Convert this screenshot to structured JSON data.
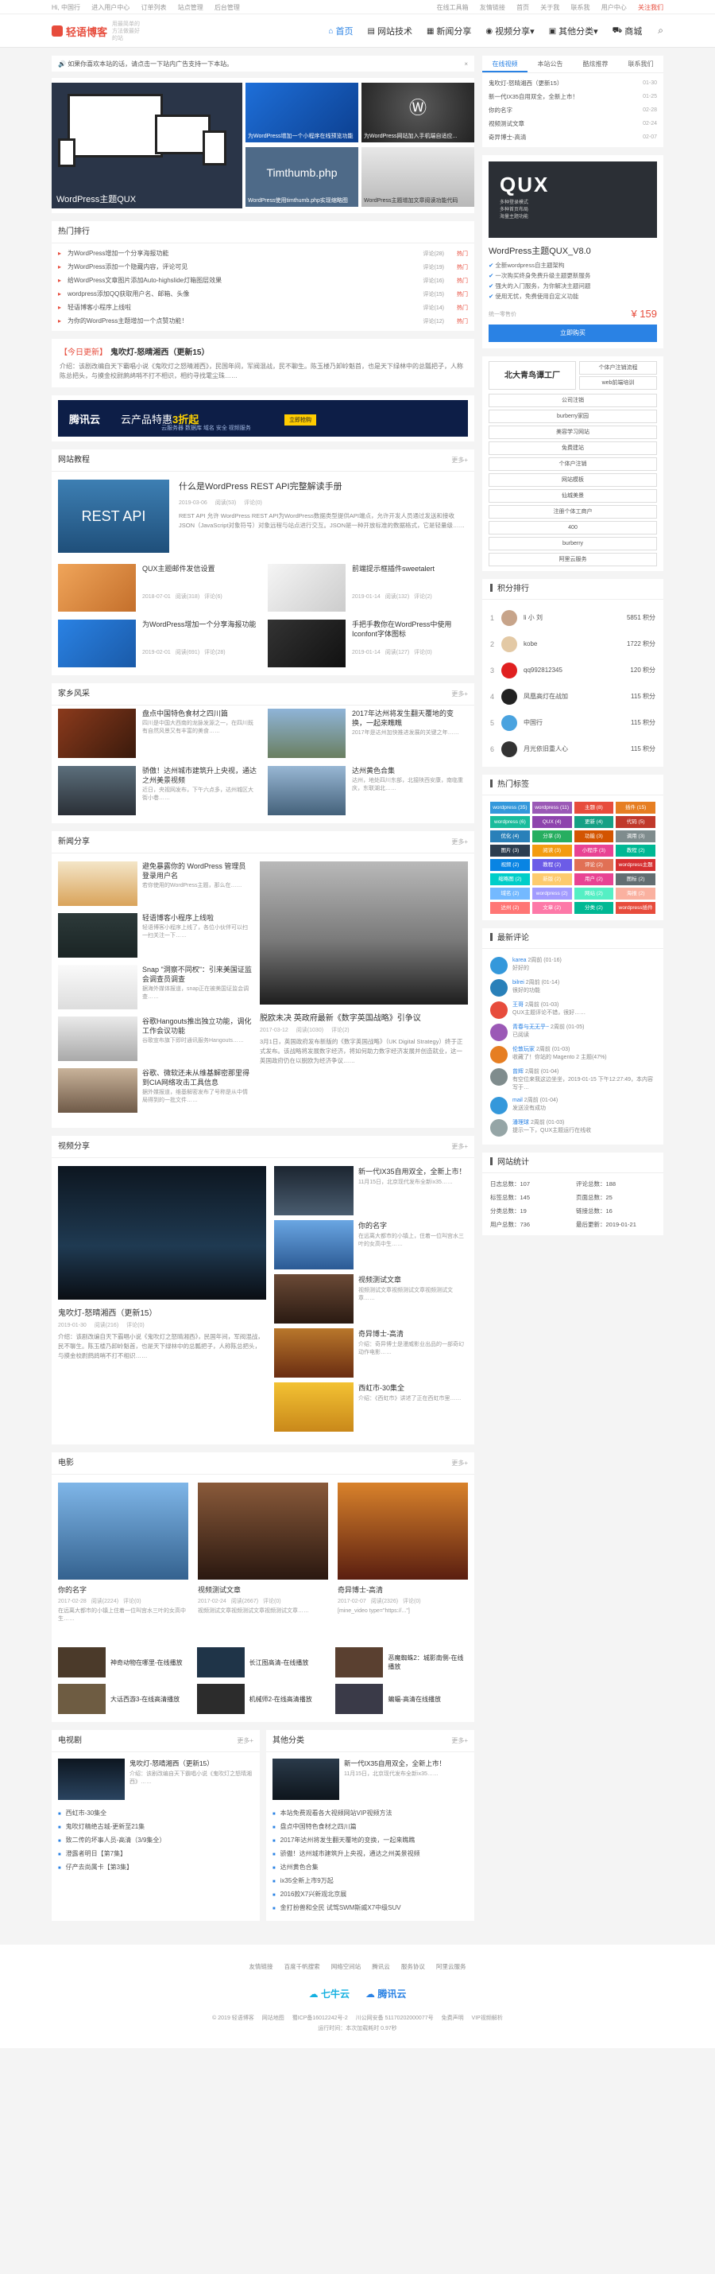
{
  "topbar": {
    "left": [
      "Hi, 中国行",
      "进入用户中心",
      "订单列表",
      "站点管理",
      "后台管理"
    ],
    "right": [
      "在线工具箱",
      "友情链接",
      "首页",
      "关于我",
      "联系我",
      "用户中心",
      "关注我们"
    ]
  },
  "header": {
    "logo": "轻语博客",
    "slogan": "用最简单的方法做最好的站",
    "nav": [
      {
        "label": "首页",
        "icon": "home-icon"
      },
      {
        "label": "网站技术",
        "icon": "code-icon"
      },
      {
        "label": "新闻分享",
        "icon": "news-icon"
      },
      {
        "label": "视频分享",
        "icon": "video-icon"
      },
      {
        "label": "其他分类",
        "icon": "grid-icon"
      },
      {
        "label": "商城",
        "icon": "cart-icon"
      }
    ]
  },
  "notice": {
    "text": "如果你喜欢本站的话，请点击一下站内广告支持一下本站。"
  },
  "slider": {
    "main_caption": "WordPress主题QUX",
    "thumbs": [
      {
        "caption": "为WordPress增加一个小程序在线预览功能"
      },
      {
        "caption": "为WordPress网站加入手机端自适应..."
      },
      {
        "title": "Timthumb.php",
        "caption": "WordPress使用timthumb.php实现缩略图"
      },
      {
        "caption": "WordPress主题增加文章阅读功能代码"
      }
    ]
  },
  "hot": {
    "title": "热门排行",
    "items": [
      {
        "t": "为WordPress增加一个分享海报功能",
        "m": "评论(28)",
        "h": "热门"
      },
      {
        "t": "为WordPress添加一个隐藏内容，评论可见",
        "m": "评论(19)",
        "h": "热门"
      },
      {
        "t": "给WordPress文章图片添加Auto-highslide灯箱图层效果",
        "m": "评论(16)",
        "h": "热门"
      },
      {
        "t": "wordpress添加QQ获取用户名、邮箱、头像",
        "m": "评论(15)",
        "h": "热门"
      },
      {
        "t": "轻语博客小程序上线啦",
        "m": "评论(14)",
        "h": "热门"
      },
      {
        "t": "为你的WordPress主题增加一个点赞功能！",
        "m": "评论(12)",
        "h": "热门"
      }
    ]
  },
  "today": {
    "label": "【今日更新】",
    "title": "鬼吹灯-怒晴湘西（更新15）",
    "text": "介绍：该剧改编自天下霸唱小说《鬼吹灯之怒晴湘西》，民国年间，军阀混战，民不聊生。陈玉楼乃卸岭魁首，也是天下绿林中的总瓢把子，人称陈总把头，与摸金校尉鹧鸪哨不打不相识，相约寻找雮尘珠……"
  },
  "ad": {
    "brand": "腾讯云",
    "text1": "云产品特惠",
    "highlight": "3折起",
    "text2": "云服务器 数据库 域名 安全 视频服务",
    "btn": "立即抢购"
  },
  "tech": {
    "title": "网站教程",
    "more": "更多+",
    "big": {
      "t": "什么是WordPress REST API完整解读手册",
      "date": "2019-03-06",
      "views": "阅读(53)",
      "comments": "评论(0)",
      "img_text": "REST API",
      "text": "REST API 允许 WordPress REST API为WordPress数据类型提供API端点，允许开发人员通过发送和接收JSON（JavaScript对象符号）对象远程与站点进行交互。JSON是一种开放标准的数据格式，它是轻量级……"
    },
    "items": [
      {
        "t": "QUX主题邮件发信设置",
        "date": "2018-07-01",
        "views": "阅读(318)",
        "c": "评论(6)"
      },
      {
        "t": "前端提示框插件sweetalert",
        "date": "2019-01-14",
        "views": "阅读(132)",
        "c": "评论(2)"
      },
      {
        "t": "为WordPress增加一个分享海报功能",
        "date": "2019-02-01",
        "views": "阅读(691)",
        "c": "评论(28)"
      },
      {
        "t": "手把手教你在WordPress中使用Iconfont字体图标",
        "date": "2019-01-14",
        "views": "阅读(127)",
        "c": "评论(0)"
      }
    ]
  },
  "hometown": {
    "title": "家乡风采",
    "more": "更多+",
    "items": [
      {
        "t": "盘点中国特色食材之四川篇",
        "p": "四川是中国大西南的龙脉发源之一，在四川既有自然风景又有丰富的美食……"
      },
      {
        "t": "2017年达州将发生翻天覆地的变换，一起来瞧瞧",
        "p": "2017年是达州加快推进发展的关键之年……"
      },
      {
        "t": "骄傲！达州城市建筑升上央视，通达之州美景视频",
        "p": "近日，央视网发布，下午六点多，达州城区大街小巷……"
      },
      {
        "t": "达州黄色合集",
        "p": "达州，地处四川东部，北接陕西安康，南临重庆，东联湖北……"
      }
    ]
  },
  "news": {
    "title": "新闻分享",
    "more": "更多+",
    "left": [
      {
        "t": "避免暴露你的 WordPress 管理员登录用户名",
        "p": "若你使用的WordPress主题，那么在……"
      },
      {
        "t": "轻语博客小程序上线啦",
        "p": "轻语博客小程序上线了，各位小伙伴可以扫一扫关注一下……"
      },
      {
        "t": "Snap \"洞察不同权\"：引来美国证监会调查员调查",
        "p": "据海外媒体报道，snap正在被美国证监会调查……"
      },
      {
        "t": "谷歌Hangouts推出独立功能，调化工作会议功能",
        "p": "谷歌宣布旗下即时通讯服务Hangouts……"
      },
      {
        "t": "谷歌、微软还未从维基解密那里得到CIA网络攻击工具信息",
        "p": "据外媒报道，维基解密发布了号称是从中情局得到的一批文件……"
      }
    ],
    "big": {
      "t": "脱欧未决 英政府最新《数字英国战略》引争议",
      "date": "2017-03-12",
      "views": "阅读(1030)",
      "comments": "评论(2)",
      "text": "3月1日，英国政府发布新版的《数字英国战略》（UK Digital Strategy）终于正式发布。该战略将发展数字经济，将如何助力数字经济发展并创造就业，这一英国政府仍在以脱欧为经济争议……"
    }
  },
  "video": {
    "title": "视频分享",
    "more": "更多+",
    "big": {
      "t": "鬼吹灯-怒晴湘西（更新15）",
      "date": "2019-01-30",
      "views": "阅读(216)",
      "comments": "评论(0)",
      "text": "介绍：该剧改编自天下霸唱小说《鬼吹灯之怒晴湘西》，民国年间，军阀混战，民不聊生。陈玉楼乃卸岭魁首，也是天下绿林中的总瓢把子，人称陈总把头，与摸金校尉鹧鸪哨不打不相识……"
    },
    "items": [
      {
        "t": "新一代IX35自用双全，全新上市！",
        "p": "11月15日，北京现代发布全新ix35……"
      },
      {
        "t": "你的名字",
        "p": "在远离大都市的小镇上，住着一位叫宫水三叶的女高中生……"
      },
      {
        "t": "视频测试文章",
        "p": "视频测试文章视频测试文章视频测试文章……"
      },
      {
        "t": "奇异博士-高清",
        "p": "介绍：奇异博士是漫威影业出品的一部奇幻动作电影……"
      },
      {
        "t": "西虹市-30集全",
        "p": "介绍：《西虹市》讲述了正在西虹市里……"
      }
    ]
  },
  "movie": {
    "title": "电影",
    "more": "更多+",
    "cards": [
      {
        "t": "你的名字",
        "date": "2017-02-28",
        "views": "阅读(2224)",
        "c": "评论(0)",
        "p": "在远离大都市的小镇上住着一位叫宫水三叶的女高中生……"
      },
      {
        "t": "视频测试文章",
        "date": "2017-02-24",
        "views": "阅读(2667)",
        "c": "评论(0)",
        "p": "视频测试文章视频测试文章视频测试文章……"
      },
      {
        "t": "奇异博士-高清",
        "date": "2017-02-07",
        "views": "阅读(2326)",
        "c": "评论(0)",
        "p": "[mine_video type=\"https://...\"]"
      }
    ],
    "list": [
      {
        "t": "神奇动物在哪里-在线播放"
      },
      {
        "t": "长江图高清-在线播放"
      },
      {
        "t": "恶魔蜘蛛2：城影南侧-在线播放"
      },
      {
        "t": "大话西游3-在线高清播放"
      },
      {
        "t": "机械师2-在线高清播放"
      },
      {
        "t": "蝙蝠-高清在线播放"
      }
    ]
  },
  "tv": {
    "title": "电视剧",
    "more": "更多+",
    "top": {
      "t": "鬼吹灯-怒晴湘西（更新15）",
      "p": "介绍：该剧改编自天下霸唱小说《鬼吹灯之怒晴湘西》……"
    },
    "items": [
      "西虹市-30集全",
      "鬼吹灯精绝古城-更新至21集",
      "致二传的坏事人员-高清（3/9集全）",
      "澄露者明日【第7集】",
      "仔产去尚属卡【第3集】"
    ]
  },
  "other": {
    "title": "其他分类",
    "more": "更多+",
    "top": {
      "t": "新一代IX35自用双全，全新上市！",
      "p": "11月15日，北京现代发布全新ix35……"
    },
    "items": [
      "本站免费观看各大视频网站VIP视频方法",
      "盘点中国特色食材之四川篇",
      "2017年达州将发生翻天覆地的变换，一起来瞧瞧",
      "骄傲！达州城市建筑升上央视，通达之州美景视频",
      "达州黄色合集",
      "ix35全新上市9万起",
      "2016款X7兴新观北京展",
      "金打扮兽和全民 试驾SWM斯威X7中级SUV"
    ]
  },
  "sidebar": {
    "tabs": [
      "在线视频",
      "本站公告",
      "酷炫推荐",
      "联系我们"
    ],
    "latest": [
      {
        "t": "鬼吹灯-怒晴湘西（更新15）",
        "d": "01-30"
      },
      {
        "t": "新一代IX35自用双全，全新上市！",
        "d": "01-25"
      },
      {
        "t": "你的名字",
        "d": "02-28"
      },
      {
        "t": "视频测试文章",
        "d": "02-24"
      },
      {
        "t": "奇异博士-高清",
        "d": "02-07"
      }
    ],
    "theme": {
      "logo": "QUX",
      "sub": "多种登录模式\n多种首页布局\n海量主题功能",
      "title": "WordPress主题QUX_V8.0",
      "features": [
        "全新wordpress自主题架构",
        "一次购买终身免费升级主题更新服务",
        "强大的入门服务，为你解决主题问题",
        "使用无忧，免费使用自定义功能"
      ],
      "price_label": "统一零售价",
      "price": "¥ 159",
      "btn": "立即购买"
    },
    "links": {
      "big": "北大青鸟谭工厂",
      "small": [
        "个体户注销流程",
        "web前端培训"
      ],
      "list": [
        "公司注销",
        "burberry家园",
        "美容学习网站",
        "免费建站",
        "个体户注销",
        "网站模板",
        "仙城美景",
        "注册个体工商户",
        "400",
        "burberry",
        "阿里云服务"
      ]
    },
    "rank": {
      "title": "积分排行",
      "items": [
        {
          "n": "1",
          "name": "li 小 刘",
          "score": "5851 积分",
          "color": "#c7a48a"
        },
        {
          "n": "2",
          "name": "kobe",
          "score": "1722 积分",
          "color": "#e3c9a5"
        },
        {
          "n": "3",
          "name": "qq992812345",
          "score": "120 积分",
          "color": "#e02020"
        },
        {
          "n": "4",
          "name": "凤凰高灯在战加",
          "score": "115 积分",
          "color": "#222222"
        },
        {
          "n": "5",
          "name": "中国行",
          "score": "115 积分",
          "color": "#4aa3df"
        },
        {
          "n": "6",
          "name": "月光依旧重人心",
          "score": "115 积分",
          "color": "#333333"
        }
      ]
    },
    "tags": {
      "title": "热门标签",
      "items": [
        {
          "t": "wordpress (35)",
          "c": "#3498db"
        },
        {
          "t": "wordpress (11)",
          "c": "#9b59b6"
        },
        {
          "t": "主题 (8)",
          "c": "#e74c3c"
        },
        {
          "t": "插件 (15)",
          "c": "#e67e22"
        },
        {
          "t": "wordpress (6)",
          "c": "#1abc9c"
        },
        {
          "t": "QUX (4)",
          "c": "#8e44ad"
        },
        {
          "t": "更新 (4)",
          "c": "#16a085"
        },
        {
          "t": "代码 (5)",
          "c": "#c0392b"
        },
        {
          "t": "优化 (4)",
          "c": "#2980b9"
        },
        {
          "t": "分享 (3)",
          "c": "#27ae60"
        },
        {
          "t": "功能 (3)",
          "c": "#d35400"
        },
        {
          "t": "调用 (3)",
          "c": "#7f8c8d"
        },
        {
          "t": "图片 (3)",
          "c": "#2c3e50"
        },
        {
          "t": "阅读 (3)",
          "c": "#f39c12"
        },
        {
          "t": "小程序 (3)",
          "c": "#e84393"
        },
        {
          "t": "教程 (2)",
          "c": "#00b894"
        },
        {
          "t": "视频 (2)",
          "c": "#0984e3"
        },
        {
          "t": "教程 (2)",
          "c": "#6c5ce7"
        },
        {
          "t": "评论 (2)",
          "c": "#e17055"
        },
        {
          "t": "wordpress主题",
          "c": "#d63031"
        },
        {
          "t": "缩略图 (2)",
          "c": "#00cec9"
        },
        {
          "t": "新版 (2)",
          "c": "#fdcb6e"
        },
        {
          "t": "用户 (2)",
          "c": "#e84393"
        },
        {
          "t": "图标 (2)",
          "c": "#636e72"
        },
        {
          "t": "域名 (2)",
          "c": "#74b9ff"
        },
        {
          "t": "wordpress (2)",
          "c": "#a29bfe"
        },
        {
          "t": "网站 (2)",
          "c": "#55efc4"
        },
        {
          "t": "海报 (2)",
          "c": "#fab1a0"
        },
        {
          "t": "达州 (2)",
          "c": "#ff7675"
        },
        {
          "t": "文章 (2)",
          "c": "#fd79a8"
        },
        {
          "t": "分类 (2)",
          "c": "#00b894"
        },
        {
          "t": "wordpress插件",
          "c": "#e74c3c"
        }
      ]
    },
    "comments": {
      "title": "最新评论",
      "items": [
        {
          "u": "karea",
          "d": "2周前 (01-16)",
          "text": "好好的",
          "color": "#3498db"
        },
        {
          "u": "bilrei",
          "d": "2周前 (01-14)",
          "text": "很好的功能",
          "color": "#2980b9"
        },
        {
          "u": "王哥",
          "d": "2周前 (01-03)",
          "text": "QUX主题评论不错，很好……",
          "color": "#e74c3c"
        },
        {
          "u": "青春与无无乎~",
          "d": "2周前 (01-05)",
          "text": "已阅读",
          "color": "#9b59b6"
        },
        {
          "u": "伦敦玩家",
          "d": "2周前 (01-03)",
          "text": "收藏了！你站的 Magento 2 主题(47%)",
          "color": "#e67e22"
        },
        {
          "u": "曾辉",
          "d": "2周前 (01-04)",
          "text": "有空位来我这边坐坐，2019-01-15 下午12:27:49，本内容写于…",
          "color": "#7f8c8d"
        },
        {
          "u": "mail",
          "d": "2周前 (01-04)",
          "text": "发送没有成功",
          "color": "#3498db"
        },
        {
          "u": "潘理球",
          "d": "2周前 (01-03)",
          "text": "提示一下，QUX主题运行在线收",
          "color": "#95a5a6"
        }
      ]
    },
    "stats": {
      "title": "网站统计",
      "items": [
        "日志总数：107",
        "评论总数：188",
        "标签总数：145",
        "页面总数：25",
        "分类总数：19",
        "链接总数：16",
        "用户总数：736",
        "最后更新：2019-01-21"
      ]
    }
  },
  "footer": {
    "links": [
      "友情链接",
      "百度千帆搜索",
      "网络空间站",
      "腾讯云",
      "服务协议",
      "阿里云服务"
    ],
    "logos": [
      "七牛云",
      "腾讯云"
    ],
    "copy": [
      "© 2019 轻语博客",
      "网站地图",
      "蜀ICP备16012242号-2",
      "川公网安备 51170202000077号",
      "免费声明",
      "VIP视频解析"
    ],
    "copy2": [
      "运行时间：本次加载耗时 0.97秒"
    ]
  }
}
